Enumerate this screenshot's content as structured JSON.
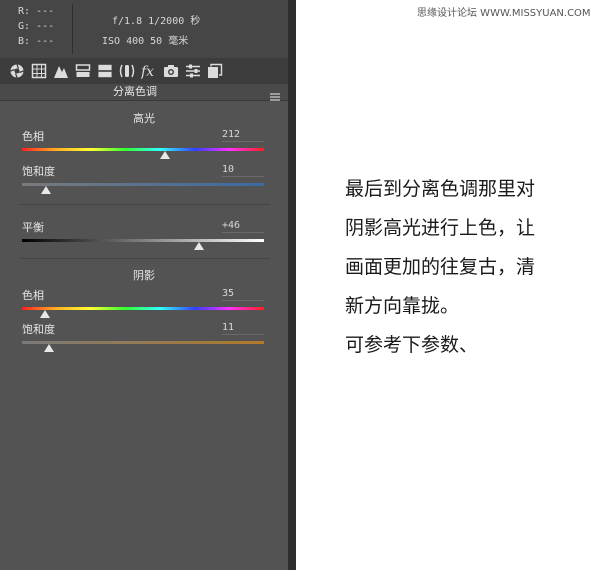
{
  "info": {
    "r": "R: ---",
    "g": "G: ---",
    "b": "B: ---",
    "exif_line1": "f/1.8  1/2000 秒",
    "exif_line2": "ISO 400  50 毫米"
  },
  "toolbar": {
    "icons": [
      "basic-aperture-icon",
      "tone-curve-grid-icon",
      "detail-triangle-icon",
      "hsl-grayscale-icon",
      "split-toning-icon",
      "lens-corrections-icon",
      "fx-effects-icon",
      "camera-calibration-icon",
      "presets-sliders-icon",
      "snapshots-icon"
    ]
  },
  "panel": {
    "title": "分离色调",
    "highlights": {
      "title": "高光",
      "hue_label": "色相",
      "hue_value": "212",
      "hue_level": 0.589,
      "sat_label": "饱和度",
      "sat_value": "10",
      "sat_level": 0.1
    },
    "balance": {
      "label": "平衡",
      "value": "+46",
      "level": 0.73
    },
    "shadows": {
      "title": "阴影",
      "hue_label": "色相",
      "hue_value": "35",
      "hue_level": 0.097,
      "sat_label": "饱和度",
      "sat_value": "11",
      "sat_level": 0.11
    }
  },
  "colors": {
    "panel_bg": "#535353",
    "info_bg": "#464646",
    "toolbar_bg": "#3c3c3c",
    "highlight_sat_track": "#3a6aa4",
    "shadow_sat_track": "#b07a2a"
  },
  "caption": {
    "lines": [
      "最后到分离色调那里对",
      "阴影高光进行上色，让",
      "画面更加的往复古，清",
      "新方向靠拢。",
      "可参考下参数、"
    ]
  },
  "watermark": "思缘设计论坛 WWW.MISSYUAN.COM"
}
